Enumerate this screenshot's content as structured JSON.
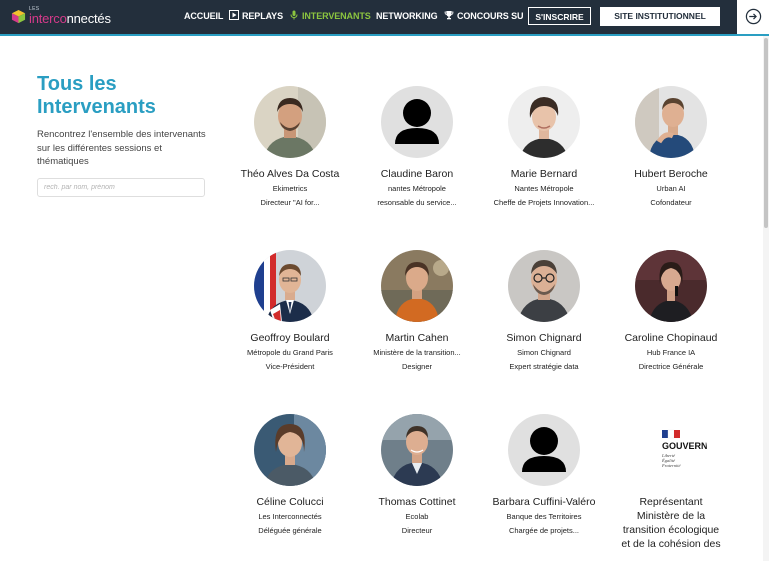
{
  "header": {
    "logo_small": "LES",
    "logo_part1": "interco",
    "logo_part2": "nnectés",
    "nav": [
      {
        "label": "ACCUEIL"
      },
      {
        "label": "REPLAYS",
        "icon": "play-icon"
      },
      {
        "label": "INTERVENANTS",
        "icon": "microphone-icon"
      },
      {
        "label": "NETWORKING"
      },
      {
        "label": "CONCOURS SU",
        "icon": "trophy-icon"
      }
    ],
    "register_label": "S'INSCRIRE",
    "institutional_label": "SITE INSTITUTIONNEL",
    "accent_color": "#2a9ec2",
    "active_color": "#8cc63f"
  },
  "intro": {
    "title": "Tous les Intervenants",
    "description": "Rencontrez l'ensemble des intervenants sur les différentes sessions et thématiques",
    "search_placeholder": "rech. par nom, prénom"
  },
  "speakers": [
    {
      "name": "Théo Alves Da Costa",
      "org": "Ekimetrics",
      "role": "Directeur \"AI for..."
    },
    {
      "name": "Claudine Baron",
      "org": "nantes Métropole",
      "role": "resonsable du service..."
    },
    {
      "name": "Marie Bernard",
      "org": "Nantes Métropole",
      "role": "Cheffe de Projets Innovation..."
    },
    {
      "name": "Hubert Beroche",
      "org": "Urban AI",
      "role": "Cofondateur"
    },
    {
      "name": "Geoffroy Boulard",
      "org": "Métropole du Grand Paris",
      "role": "Vice-Président"
    },
    {
      "name": "Martin Cahen",
      "org": "Ministère de la transition...",
      "role": "Designer"
    },
    {
      "name": "Simon Chignard",
      "org": "Simon Chignard",
      "role": "Expert stratégie data"
    },
    {
      "name": "Caroline Chopinaud",
      "org": "Hub France IA",
      "role": "Directrice Générale"
    },
    {
      "name": "Céline Colucci",
      "org": "Les Interconnectés",
      "role": "Déléguée générale"
    },
    {
      "name": "Thomas Cottinet",
      "org": "Ecolab",
      "role": "Directeur"
    },
    {
      "name": "Barbara Cuffini-Valéro",
      "org": "Banque des Territoires",
      "role": "Chargée de projets..."
    },
    {
      "name": "Représentant Ministère de la transition écologique et de la cohésion des",
      "org": "",
      "role": ""
    }
  ],
  "gov_logo": {
    "title": "GOUVERNEMENT",
    "motto": [
      "Liberté",
      "Égalité",
      "Fraternité"
    ]
  }
}
